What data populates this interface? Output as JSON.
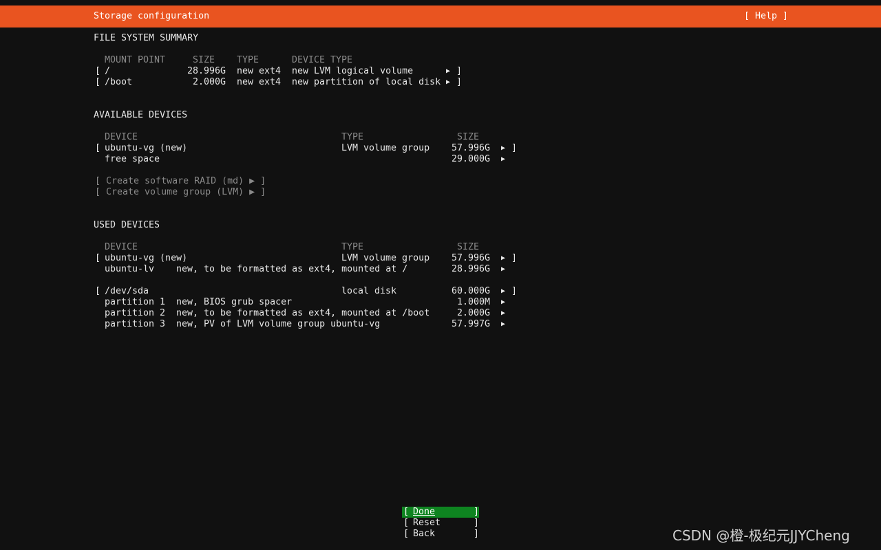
{
  "header": {
    "title": "Storage configuration",
    "help": "[ Help ]"
  },
  "fs_summary": {
    "heading": "FILE SYSTEM SUMMARY",
    "columns": [
      "MOUNT POINT",
      "SIZE",
      "TYPE",
      "DEVICE TYPE"
    ],
    "rows": [
      {
        "mount": "/",
        "size": "28.996G",
        "type": "new ext4",
        "device_type": "new LVM logical volume"
      },
      {
        "mount": "/boot",
        "size": "2.000G",
        "type": "new ext4",
        "device_type": "new partition of local disk"
      }
    ]
  },
  "available": {
    "heading": "AVAILABLE DEVICES",
    "columns": [
      "DEVICE",
      "TYPE",
      "SIZE"
    ],
    "rows": [
      {
        "device": "ubuntu-vg (new)",
        "type": "LVM volume group",
        "size": "57.996G"
      },
      {
        "device": "free space",
        "type": "",
        "size": "29.000G"
      }
    ],
    "actions": [
      "[ Create software RAID (md) ▶ ]",
      "[ Create volume group (LVM) ▶ ]"
    ]
  },
  "used": {
    "heading": "USED DEVICES",
    "columns": [
      "DEVICE",
      "TYPE",
      "SIZE"
    ],
    "vg": {
      "device": "ubuntu-vg (new)",
      "type": "LVM volume group",
      "size": "57.996G"
    },
    "lv": {
      "device": "ubuntu-lv",
      "desc": "new, to be formatted as ext4, mounted at /",
      "size": "28.996G"
    },
    "disk": {
      "device": "/dev/sda",
      "type": "local disk",
      "size": "60.000G"
    },
    "partitions": [
      {
        "name": "partition 1",
        "desc": "new, BIOS grub spacer",
        "size": "1.000M"
      },
      {
        "name": "partition 2",
        "desc": "new, to be formatted as ext4, mounted at /boot",
        "size": "2.000G"
      },
      {
        "name": "partition 3",
        "desc": "new, PV of LVM volume group ubuntu-vg",
        "size": "57.997G"
      }
    ]
  },
  "buttons": {
    "done": "Done",
    "reset": "Reset",
    "back": "Back"
  },
  "glyphs": {
    "open": "[",
    "close": "]",
    "arrow": "▶"
  },
  "watermark": "CSDN @橙-极纪元JJYCheng",
  "colors": {
    "header": "#e95420",
    "background": "#111111",
    "primary_button": "#0e8420",
    "dim_text": "#8a8a8a"
  }
}
